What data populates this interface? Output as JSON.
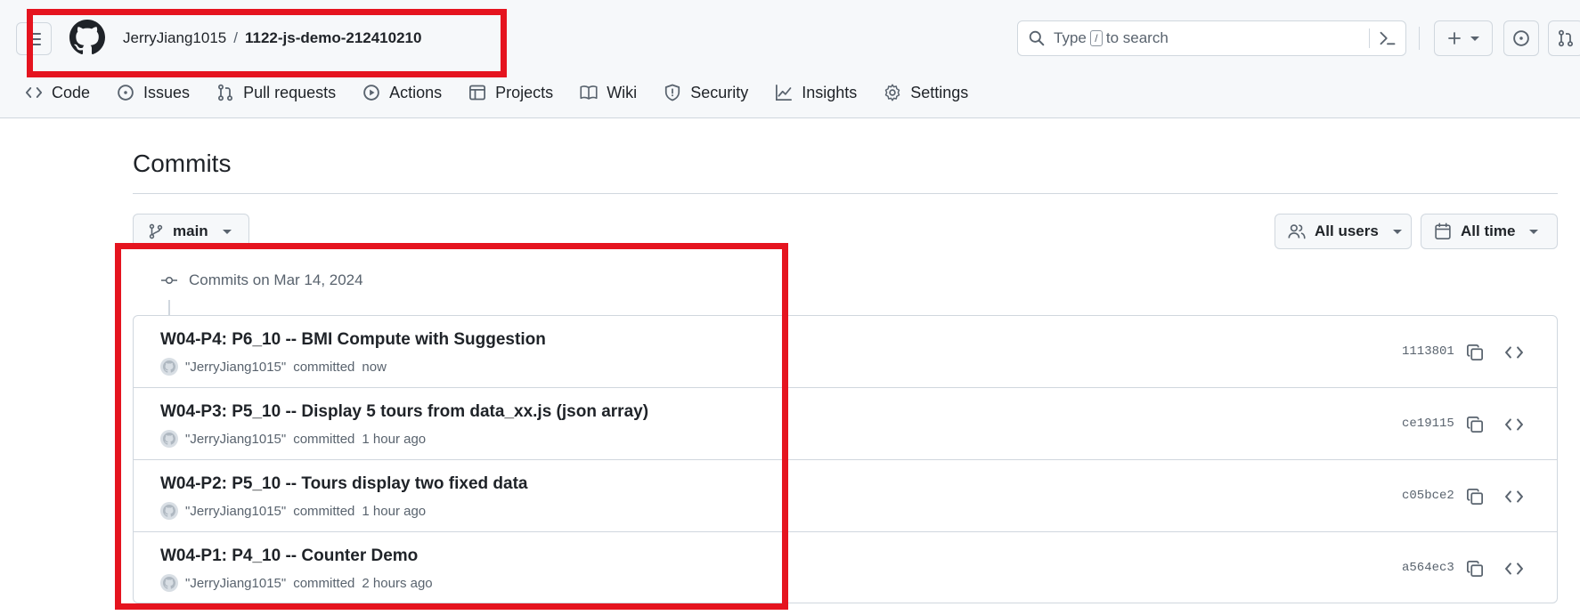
{
  "header": {
    "owner": "JerryJiang1015",
    "separator": "/",
    "repo": "1122-js-demo-212410210",
    "search": {
      "prefix": "Type",
      "key": "/",
      "suffix": "to search"
    },
    "plus_label": "+"
  },
  "tabs": [
    {
      "label": "Code",
      "icon": "code-icon"
    },
    {
      "label": "Issues",
      "icon": "issue-icon"
    },
    {
      "label": "Pull requests",
      "icon": "pull-request-icon"
    },
    {
      "label": "Actions",
      "icon": "play-icon"
    },
    {
      "label": "Projects",
      "icon": "table-icon"
    },
    {
      "label": "Wiki",
      "icon": "book-icon"
    },
    {
      "label": "Security",
      "icon": "shield-icon"
    },
    {
      "label": "Insights",
      "icon": "graph-icon"
    },
    {
      "label": "Settings",
      "icon": "gear-icon"
    }
  ],
  "main": {
    "title": "Commits",
    "branch": "main",
    "users_filter": "All users",
    "time_filter": "All time",
    "group_heading": "Commits on Mar 14, 2024"
  },
  "commits": [
    {
      "title": "W04-P4: P6_10 -- BMI Compute with Suggestion",
      "author": "\"JerryJiang1015\"",
      "action": "committed",
      "time": "now",
      "sha": "1113801"
    },
    {
      "title": "W04-P3: P5_10 -- Display 5 tours from data_xx.js (json array)",
      "author": "\"JerryJiang1015\"",
      "action": "committed",
      "time": "1 hour ago",
      "sha": "ce19115"
    },
    {
      "title": "W04-P2: P5_10 -- Tours display two fixed data",
      "author": "\"JerryJiang1015\"",
      "action": "committed",
      "time": "1 hour ago",
      "sha": "c05bce2"
    },
    {
      "title": "W04-P1: P4_10 -- Counter Demo",
      "author": "\"JerryJiang1015\"",
      "action": "committed",
      "time": "2 hours ago",
      "sha": "a564ec3"
    }
  ],
  "colors": {
    "annotation_red": "#e5141f",
    "border": "#d0d7de",
    "muted_text": "#59636e"
  }
}
